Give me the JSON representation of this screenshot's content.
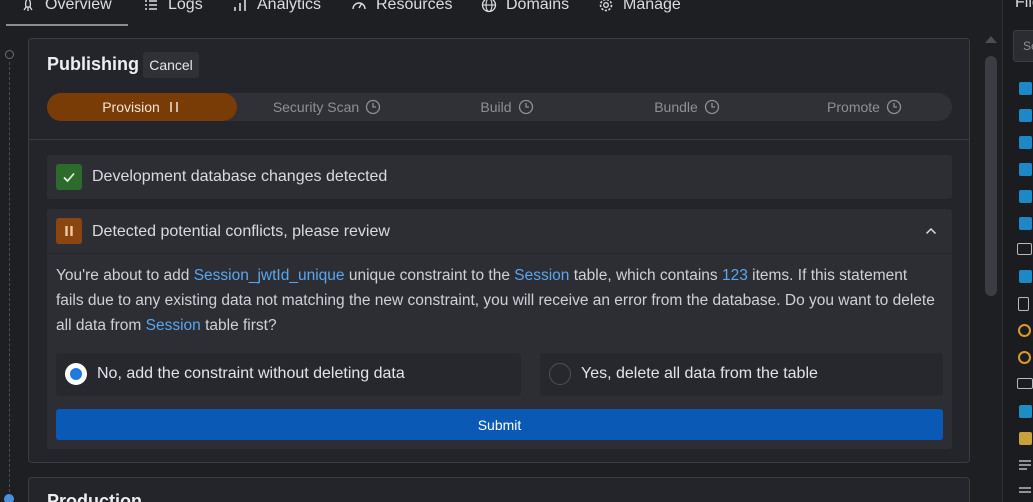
{
  "nav": {
    "items": [
      {
        "label": "Overview",
        "icon": "rocket-icon"
      },
      {
        "label": "Logs",
        "icon": "list-icon"
      },
      {
        "label": "Analytics",
        "icon": "bar-chart-icon"
      },
      {
        "label": "Resources",
        "icon": "gauge-icon"
      },
      {
        "label": "Domains",
        "icon": "globe-icon"
      },
      {
        "label": "Manage",
        "icon": "gear-icon"
      }
    ],
    "active": "Overview"
  },
  "publishing": {
    "title": "Publishing",
    "cancel_label": "Cancel",
    "steps": [
      {
        "label": "Provision",
        "status": "in-progress",
        "icon": "pause-icon"
      },
      {
        "label": "Security Scan",
        "status": "pending",
        "icon": "clock-icon"
      },
      {
        "label": "Build",
        "status": "pending",
        "icon": "clock-icon"
      },
      {
        "label": "Bundle",
        "status": "pending",
        "icon": "clock-icon"
      },
      {
        "label": "Promote",
        "status": "pending",
        "icon": "clock-icon"
      }
    ],
    "success_message": "Development database changes detected",
    "conflict": {
      "title": "Detected potential conflicts, please review",
      "message": {
        "p1": "You're about to add ",
        "constraint": "Session_jwtId_unique",
        "p2": " unique constraint to the ",
        "table1": "Session",
        "p3": " table, which contains ",
        "count": "123",
        "p4": " items. If this statement fails due to any existing data not matching the new constraint, you will receive an error from the database. Do you want to delete all data from ",
        "table2": "Session",
        "p5": " table first?"
      },
      "options": [
        {
          "label": "No, add the constraint without deleting data",
          "selected": true
        },
        {
          "label": "Yes, delete all data from the table",
          "selected": false
        }
      ],
      "submit_label": "Submit"
    }
  },
  "production": {
    "title": "Production"
  },
  "files": {
    "title": "Files",
    "search_placeholder": "Search"
  },
  "colors": {
    "accent_blue": "#0a59b5",
    "highlight": "#5aa6ef",
    "active_step": "#7a3c06",
    "success": "#2d6b2c",
    "warning": "#8a4610"
  }
}
